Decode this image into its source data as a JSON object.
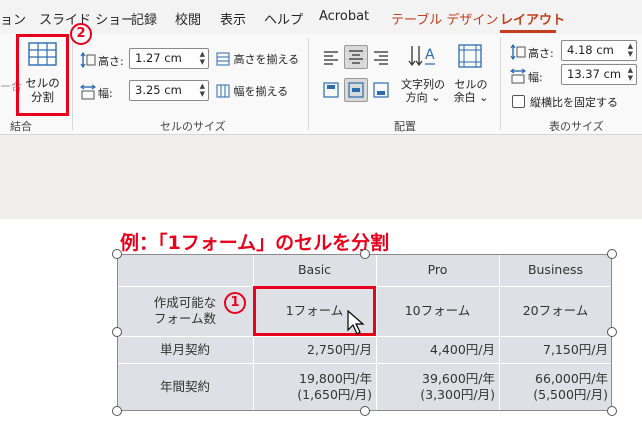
{
  "menu": {
    "items": [
      "ョン",
      "スライド ショー",
      "記録",
      "校閲",
      "表示",
      "ヘルプ",
      "Acrobat",
      "テーブル デザイン",
      "レイアウト"
    ],
    "accent_color": "#c43e1c"
  },
  "ribbon": {
    "merge_group": {
      "partial_label": "ー合",
      "split_cells_line1": "セルの",
      "split_cells_line2": "分割",
      "label": "結合"
    },
    "cell_size_group": {
      "height_label": "高さ:",
      "height_value": "1.27 cm",
      "width_label": "幅:",
      "width_value": "3.25 cm",
      "distribute_rows": "高さを揃える",
      "distribute_cols": "幅を揃える",
      "label": "セルのサイズ"
    },
    "alignment_group": {
      "text_direction_line1": "文字列の",
      "text_direction_line2": "方向 ⌄",
      "cell_margins_line1": "セルの",
      "cell_margins_line2": "余白 ⌄",
      "label": "配置"
    },
    "table_size_group": {
      "height_label": "高さ:",
      "height_value": "4.18 cm",
      "width_label": "幅:",
      "width_value": "13.37 cm",
      "lock_aspect": "縦横比を固定する",
      "label": "表のサイズ"
    }
  },
  "annotations": {
    "step1": "1",
    "step2": "2",
    "highlight_color": "#e8001c",
    "caption": "例：「1フォーム」のセルを分割"
  },
  "table": {
    "headers": [
      "",
      "Basic",
      "Pro",
      "Business"
    ],
    "rows": [
      {
        "label_line1": "作成可能な",
        "label_line2": "フォーム数",
        "basic": "1フォーム",
        "pro": "10フォーム",
        "business": "20フォーム"
      },
      {
        "label_line1": "単月契約",
        "basic": "2,750円/月",
        "pro": "4,400円/月",
        "business": "7,150円/月"
      },
      {
        "label_line1": "年間契約",
        "basic": "19,800円/年",
        "basic2": "(1,650円/月)",
        "pro": "39,600円/年",
        "pro2": "(3,300円/月)",
        "business": "66,000円/年",
        "business2": "(5,500円/月)"
      }
    ]
  }
}
